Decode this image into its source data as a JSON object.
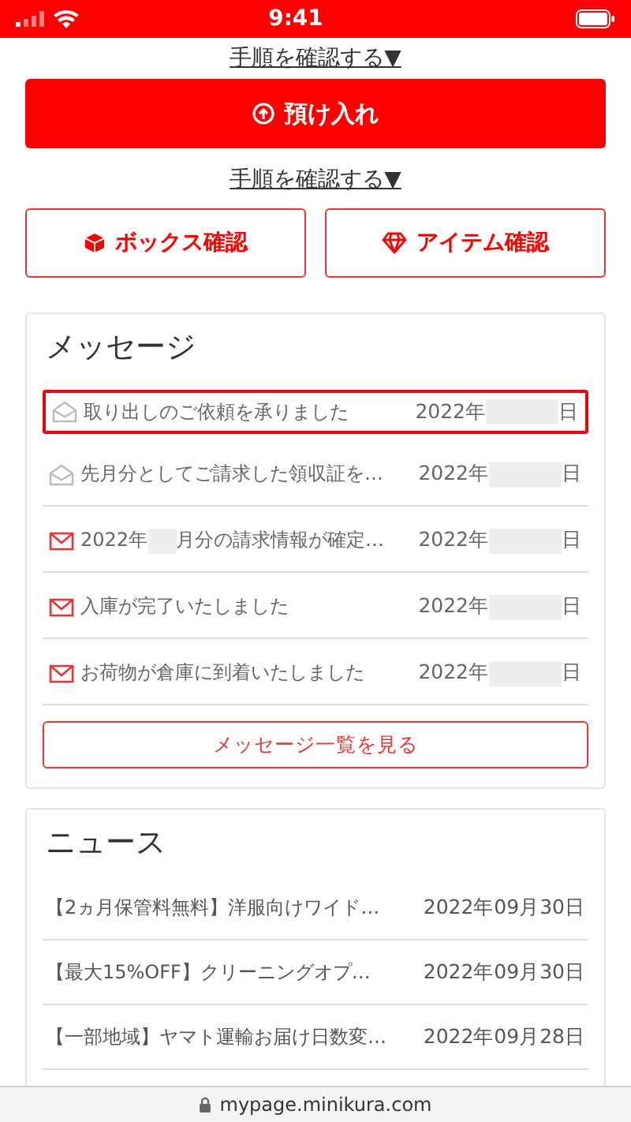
{
  "status_bar": {
    "time": "9:41"
  },
  "top_link": "手順を確認する▼",
  "deposit_button": "預け入れ",
  "procedure_link": "手順を確認する▼",
  "action_buttons": [
    {
      "kind": "box",
      "label": "ボックス確認"
    },
    {
      "kind": "item",
      "label": "アイテム確認"
    }
  ],
  "messages": {
    "title": "メッセージ",
    "items": [
      {
        "title_parts": [
          "取り出しのご依頼を承りました"
        ],
        "date_parts": [
          "2022年",
          "日"
        ],
        "read": true,
        "selected": true
      },
      {
        "title_parts": [
          "先月分としてご請求した領収証を…"
        ],
        "date_parts": [
          "2022年",
          "日"
        ],
        "read": true,
        "selected": false
      },
      {
        "title_parts": [
          "2022年",
          "月分の請求情報が確定…"
        ],
        "date_parts": [
          "2022年",
          "日"
        ],
        "read": false,
        "selected": false
      },
      {
        "title_parts": [
          "入庫が完了いたしました"
        ],
        "date_parts": [
          "2022年",
          "日"
        ],
        "read": false,
        "selected": false
      },
      {
        "title_parts": [
          "お荷物が倉庫に到着いたしました"
        ],
        "date_parts": [
          "2022年",
          "日"
        ],
        "read": false,
        "selected": false
      }
    ],
    "view_all": "メッセージ一覧を見る"
  },
  "news": {
    "title": "ニュース",
    "items": [
      {
        "title": "【2ヵ月保管料無料】洋服向けワイド…",
        "date": "2022年09月30日"
      },
      {
        "title": "【最大15%OFF】クリーニングオプ…",
        "date": "2022年09月30日"
      },
      {
        "title": "【一部地域】ヤマト運輸お届け日数変…",
        "date": "2022年09月28日"
      }
    ]
  },
  "url_bar": {
    "url": "mypage.minikura.com"
  }
}
